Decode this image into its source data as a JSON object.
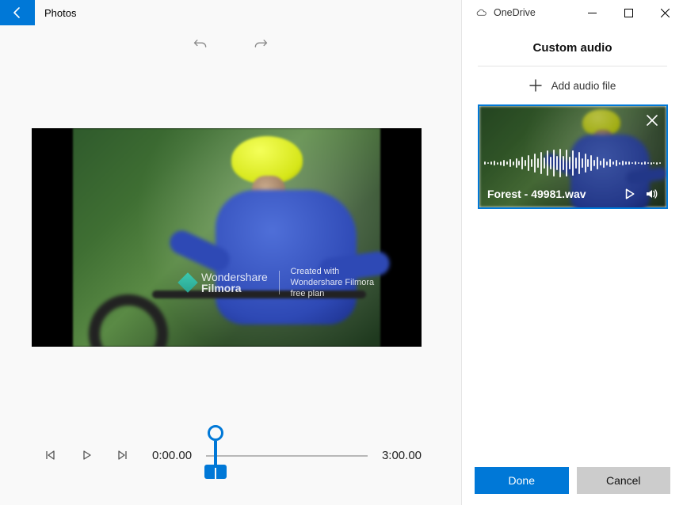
{
  "app": {
    "title": "Photos"
  },
  "toolbar": {
    "undo": "Undo",
    "redo": "Redo"
  },
  "video": {
    "watermark": {
      "brand_line1": "Wondershare",
      "brand_line2": "Filmora",
      "created_with": "Created with",
      "plan_line": "Wondershare Filmora free plan"
    }
  },
  "playback": {
    "prev_frame": "Previous frame",
    "play": "Play",
    "next_frame": "Next frame",
    "current_time": "0:00.00",
    "total_time": "3:00.00",
    "position_pct": 5
  },
  "titlebar": {
    "cloud_label": "OneDrive",
    "minimize": "Minimize",
    "maximize": "Maximize",
    "close": "Close"
  },
  "panel": {
    "title": "Custom audio",
    "add_label": "Add audio file",
    "audio_items": [
      {
        "name": "Forest - 49981.wav"
      }
    ],
    "done_label": "Done",
    "cancel_label": "Cancel"
  },
  "colors": {
    "accent": "#0078d7"
  }
}
